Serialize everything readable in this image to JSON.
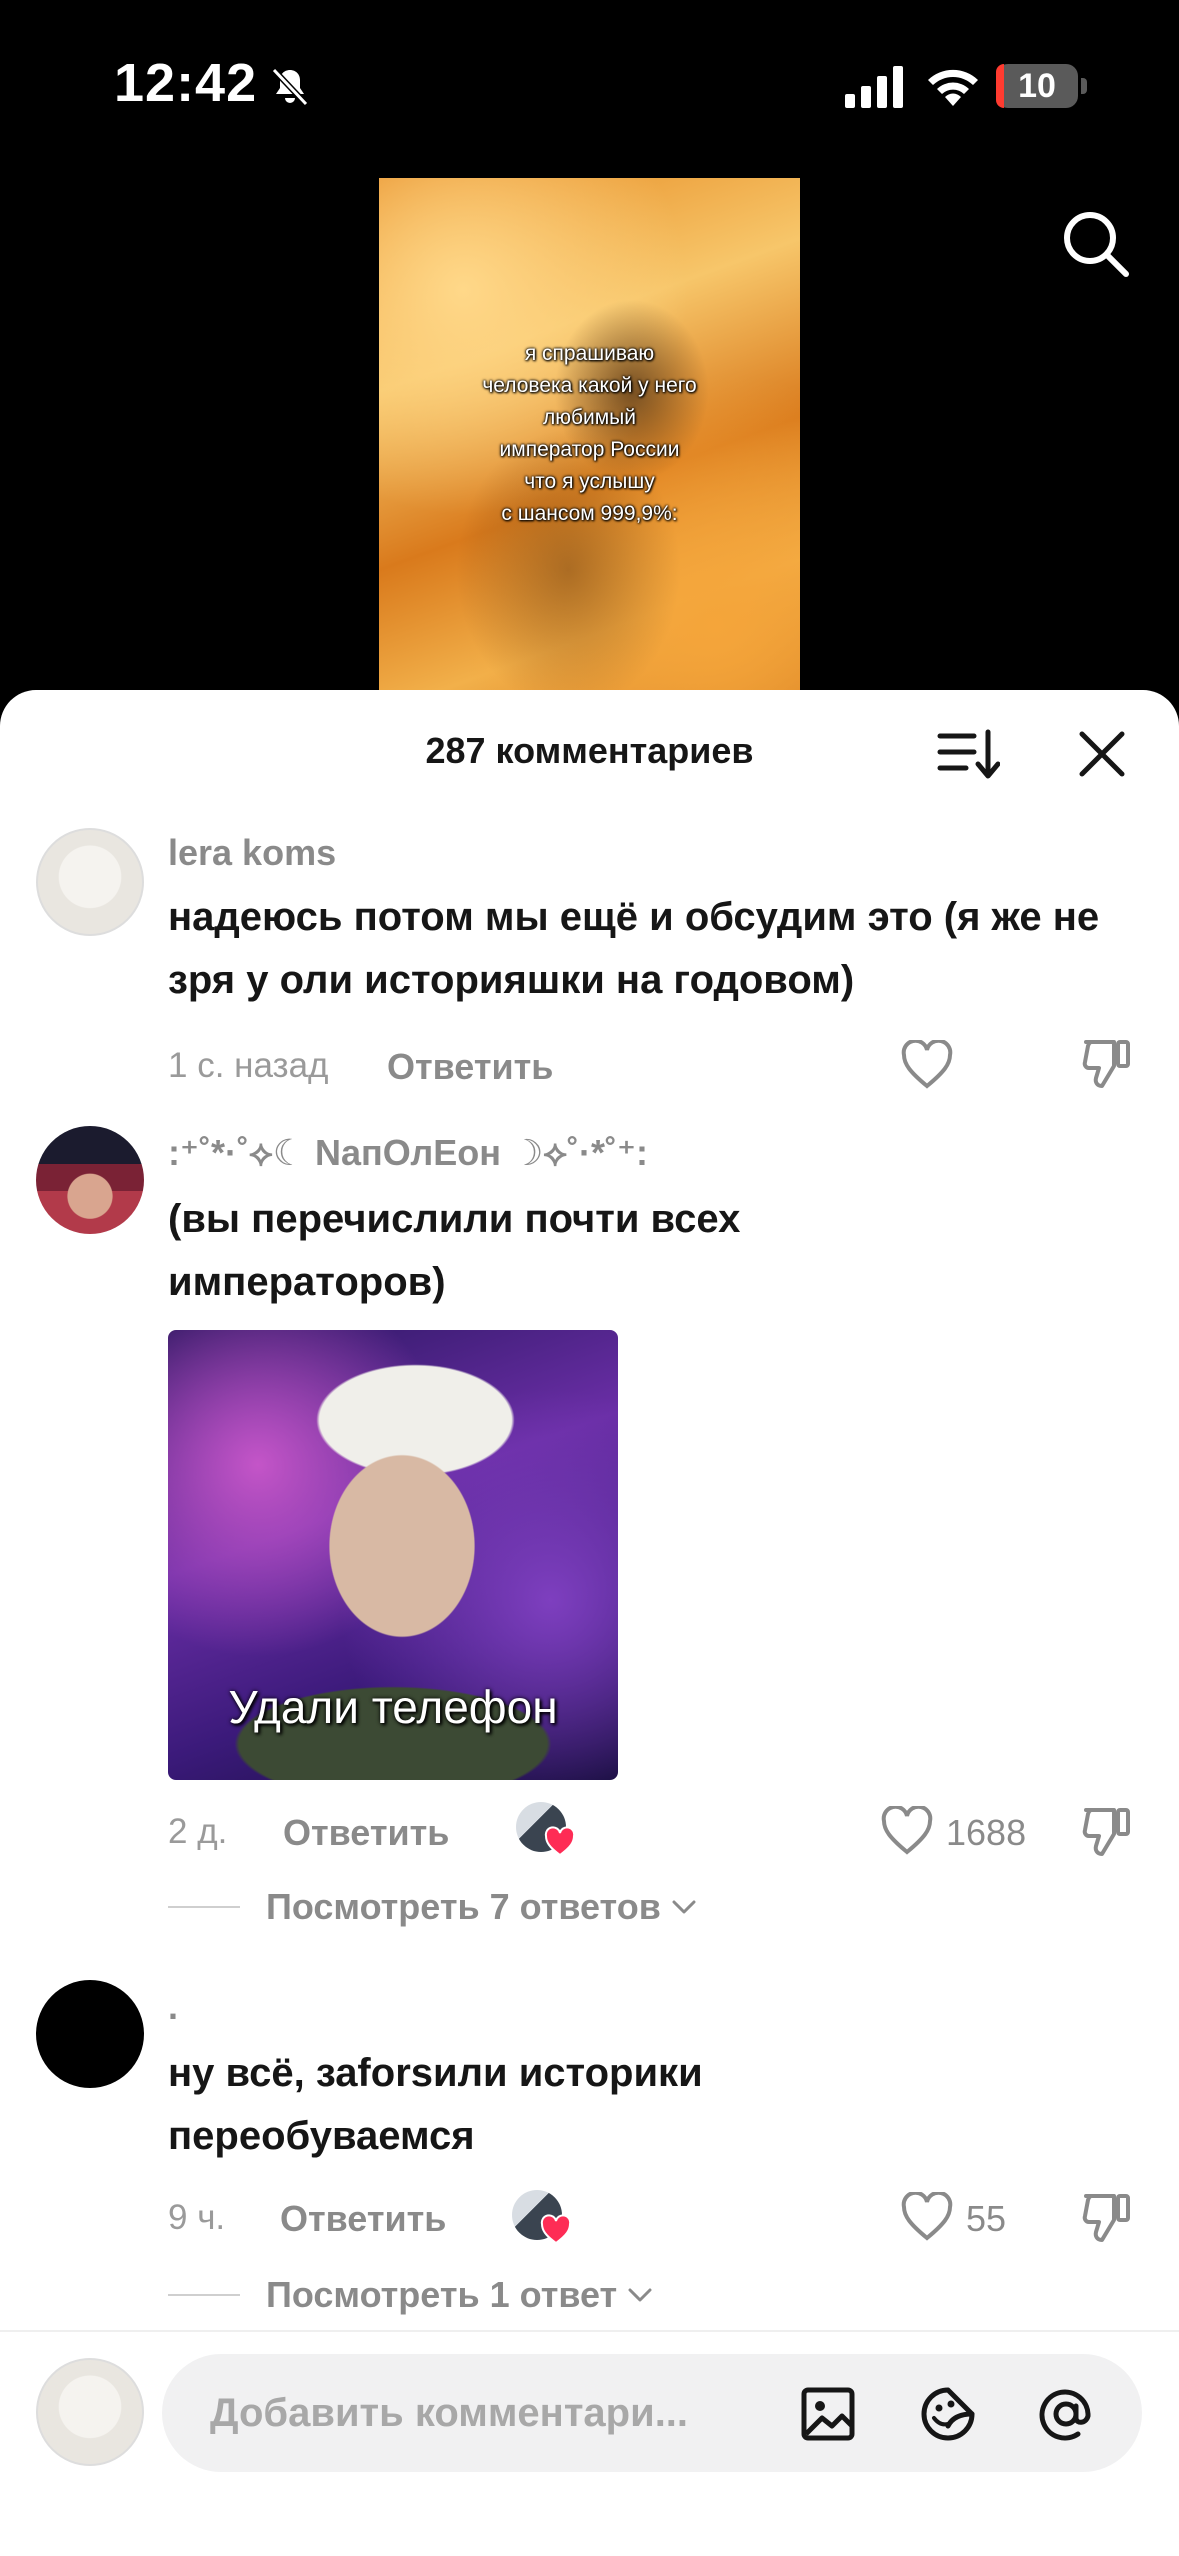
{
  "status_bar": {
    "time": "12:42",
    "battery": "10",
    "battery_level": 0.1
  },
  "video": {
    "caption": "я спрашиваю\nчеловека какой у него\nлюбимый\nимператор России\nчто я услышу\nс шансом 999,9%:"
  },
  "sheet": {
    "title": "287 комментариев"
  },
  "comments": [
    {
      "user": "lera koms",
      "text": "надеюсь потом мы ещё и обсудим это (я же не зря у оли историяшки на годовом)",
      "time": "1 с. назад",
      "reply": "Ответить"
    },
    {
      "user": ":⁺˚*·˚⟡☾ NапОлЕон ☽⟡˚·*˚⁺:",
      "text": "(вы перечислили почти всех императоров)",
      "gif_text": "Удали телефон",
      "time": "2 д.",
      "reply": "Ответить",
      "likes": "1688",
      "view_replies": "Посмотреть 7 ответов"
    },
    {
      "user": ".",
      "text": "ну всё, заforsили историки переобуваемся",
      "time": "9 ч.",
      "reply": "Ответить",
      "likes": "55",
      "view_replies": "Посмотреть 1 ответ"
    }
  ],
  "input": {
    "placeholder": "Добавить комментари..."
  },
  "colors": {
    "heart": "#fe2c55",
    "text": "#161616",
    "muted": "#8a8a8a",
    "battery_low": "#ff3b30"
  }
}
